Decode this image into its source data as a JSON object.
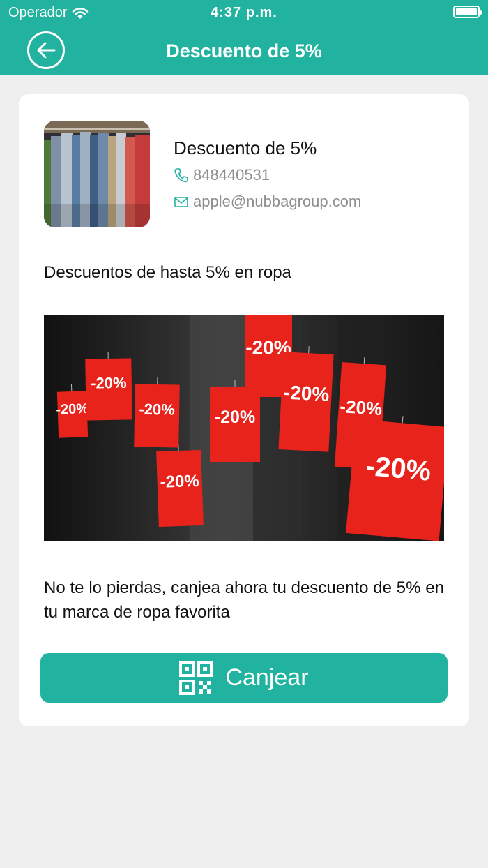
{
  "status_bar": {
    "carrier": "Operador",
    "time": "4:37 p.m."
  },
  "nav": {
    "title": "Descuento de 5%",
    "back_icon": "arrow-left-circle-icon"
  },
  "store": {
    "name": "Descuento de 5%",
    "phone": "848440531",
    "email": "apple@nubbagroup.com",
    "image": "clothes-rack-image"
  },
  "offer": {
    "description": "Descuentos de hasta 5% en ropa",
    "promo_image": "discount-tags-image",
    "tag_text": "-20%",
    "call_to_action": "No te lo pierdas, canjea ahora tu descuento de 5% en tu marca de ropa favorita"
  },
  "redeem_button": {
    "label": "Canjear",
    "icon": "qr-code-icon"
  },
  "colors": {
    "accent": "#22b3a0",
    "background": "#efefef",
    "card": "#ffffff",
    "tag": "#e8231c"
  }
}
